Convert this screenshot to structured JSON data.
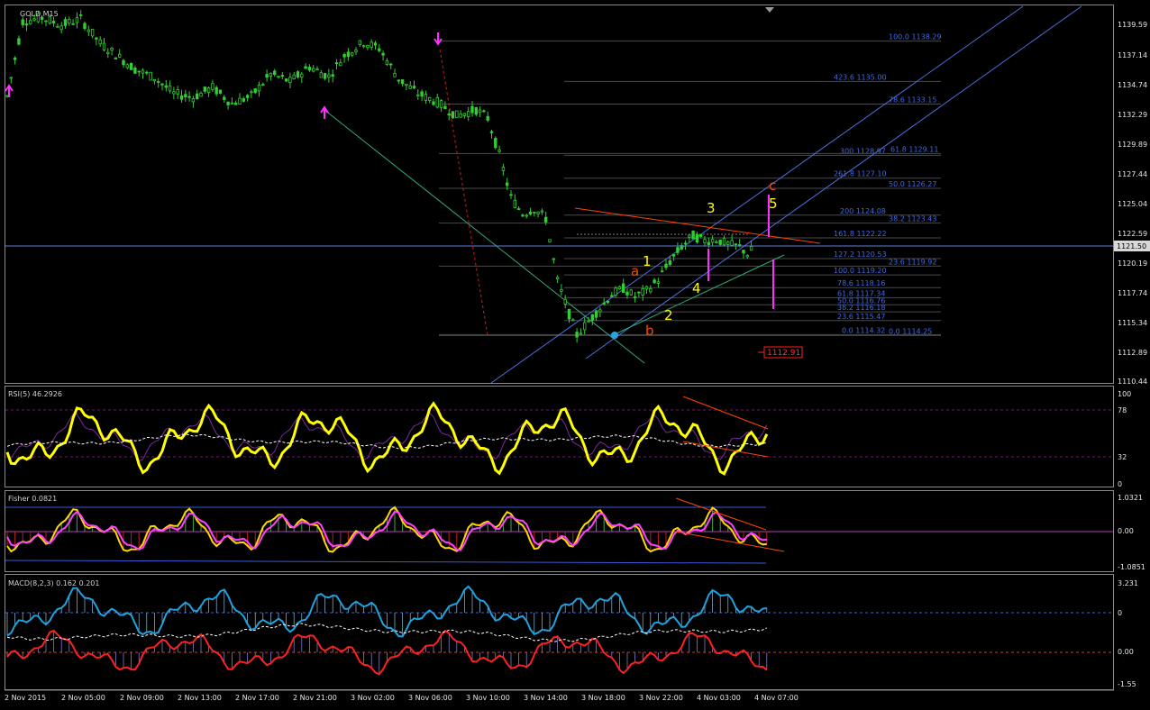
{
  "chart_data": {
    "type": "candlestick",
    "symbol_label": "GOLD,M15",
    "current_price": "1121.50",
    "main_axis": {
      "ticks": [
        "1139.59",
        "1137.14",
        "1134.74",
        "1132.29",
        "1129.89",
        "1127.44",
        "1125.04",
        "1122.59",
        "1120.19",
        "1117.74",
        "1115.34",
        "1112.89",
        "1110.44"
      ],
      "min": 1110.44,
      "max": 1140.4
    },
    "x_labels": [
      "2 Nov 2015",
      "2 Nov 05:00",
      "2 Nov 09:00",
      "2 Nov 13:00",
      "2 Nov 17:00",
      "2 Nov 21:00",
      "3 Nov 02:00",
      "3 Nov 06:00",
      "3 Nov 10:00",
      "3 Nov 14:00",
      "3 Nov 18:00",
      "3 Nov 22:00",
      "4 Nov 03:00",
      "4 Nov 07:00"
    ],
    "price_path": [
      [
        0,
        1133.8
      ],
      [
        4,
        1139.9
      ],
      [
        9,
        1140.2
      ],
      [
        14,
        1139.6
      ],
      [
        19,
        1140.1
      ],
      [
        24,
        1138.1
      ],
      [
        28,
        1137.2
      ],
      [
        33,
        1136.0
      ],
      [
        38,
        1135.3
      ],
      [
        43,
        1134.0
      ],
      [
        48,
        1133.7
      ],
      [
        53,
        1134.5
      ],
      [
        58,
        1133.2
      ],
      [
        63,
        1133.8
      ],
      [
        68,
        1135.6
      ],
      [
        73,
        1135.0
      ],
      [
        78,
        1136.2
      ],
      [
        83,
        1135.4
      ],
      [
        87,
        1137.1
      ],
      [
        92,
        1138.2
      ],
      [
        96,
        1137.7
      ],
      [
        101,
        1135.2
      ],
      [
        106,
        1134.0
      ],
      [
        111,
        1133.3
      ],
      [
        116,
        1132.2
      ],
      [
        121,
        1132.7
      ],
      [
        124,
        1132.0
      ],
      [
        127,
        1129.0
      ],
      [
        130,
        1125.5
      ],
      [
        133,
        1124.2
      ],
      [
        136,
        1124.6
      ],
      [
        139,
        1123.8
      ],
      [
        142,
        1118.7
      ],
      [
        145,
        1116.0
      ],
      [
        147,
        1114.3
      ],
      [
        150,
        1115.4
      ],
      [
        153,
        1116.5
      ],
      [
        156,
        1117.6
      ],
      [
        159,
        1118.1
      ],
      [
        162,
        1117.4
      ],
      [
        165,
        1117.9
      ],
      [
        168,
        1118.8
      ],
      [
        171,
        1120.3
      ],
      [
        174,
        1121.5
      ],
      [
        177,
        1122.4
      ],
      [
        180,
        1122.0
      ],
      [
        183,
        1122.1
      ],
      [
        186,
        1121.7
      ],
      [
        189,
        1121.5
      ],
      [
        191,
        1120.9
      ],
      [
        193,
        1121.5
      ]
    ],
    "horizontal_levels": [
      {
        "level": "100.0",
        "price": "1138.29"
      },
      {
        "level": "423.6",
        "price": "1135.00"
      },
      {
        "level": "78.6",
        "price": "1133.15"
      },
      {
        "level": "300",
        "price": "1128.97"
      },
      {
        "level": "61.8",
        "price": "1129.11"
      },
      {
        "level": "261.8",
        "price": "1127.10"
      },
      {
        "level": "50.0",
        "price": "1126.27"
      },
      {
        "level": "200",
        "price": "1124.08"
      },
      {
        "level": "38.2",
        "price": "1123.43"
      },
      {
        "level": "161.8",
        "price": "1122.22"
      },
      {
        "level": "127.2",
        "price": "1120.53"
      },
      {
        "level": "23.6",
        "price": "1119.92"
      },
      {
        "level": "100.0",
        "price": "1119.20"
      },
      {
        "level": "78.6",
        "price": "1118.16"
      },
      {
        "level": "61.8",
        "price": "1117.34"
      },
      {
        "level": "50.0",
        "price": "1116.76"
      },
      {
        "level": "38.2",
        "price": "1116.18"
      },
      {
        "level": "23.6",
        "price": "1115.47"
      },
      {
        "level": "0.0",
        "price": "1114.32"
      },
      {
        "level": "0.0",
        "price": "1114.25"
      }
    ],
    "price_box": "1112.91",
    "wave_labels": [
      "1",
      "2",
      "3",
      "4",
      "5",
      "a",
      "b",
      "c"
    ],
    "indicators": [
      {
        "name": "RSI(5) 46.2926",
        "axis": [
          "100",
          "78",
          "32",
          "0"
        ]
      },
      {
        "name": "Fisher 0.0821",
        "axis": [
          "1.0321",
          "0.00",
          "-1.0851"
        ]
      },
      {
        "name": "MACD(8,2,3) 0.162 0.201",
        "axis": [
          "3.231",
          "0",
          "0.00",
          "-1.55"
        ]
      }
    ],
    "colors": {
      "background": "#000000",
      "candle": "#32cd32",
      "grid": "#4a4a4a",
      "fib_blue": "#4169e1",
      "rsi": "#ffff00",
      "macd_blue": "#1fa3e0",
      "macd_red": "#ff2020",
      "fisher_pink": "#ff40ff",
      "arrow": "#ff30ff",
      "wave_yellow": "#ffff00",
      "wave_orange": "#ff4500"
    }
  }
}
